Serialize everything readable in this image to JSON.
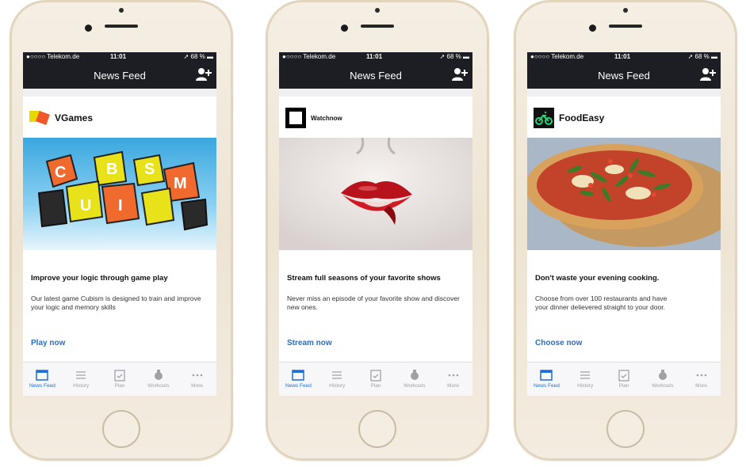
{
  "status": {
    "carrier": "●○○○○ Telekom.de",
    "time": "11:01",
    "battery": "68 %"
  },
  "nav": {
    "title": "News Feed"
  },
  "tabs": [
    {
      "label": "News Feed",
      "icon": "news-feed-icon"
    },
    {
      "label": "History",
      "icon": "history-icon"
    },
    {
      "label": "Plan",
      "icon": "plan-icon"
    },
    {
      "label": "Workouts",
      "icon": "workouts-icon"
    },
    {
      "label": "More",
      "icon": "more-icon"
    }
  ],
  "colors": {
    "accent": "#1f6fd6",
    "bar": "#1c1e23"
  },
  "phones": [
    {
      "brand": "VGames",
      "hero_text": [
        "C",
        "U",
        "B",
        "S",
        "I",
        "M"
      ],
      "headline": "Improve your logic through game play",
      "body": "Our latest game Cubism is designed to train and improve your logic and memory skills",
      "cta": "Play now"
    },
    {
      "brand": "Watchnow",
      "headline": "Stream full seasons of your favorite shows",
      "body": "Never miss an episode of your favorite show and discover new ones.",
      "cta": "Stream now"
    },
    {
      "brand": "FoodEasy",
      "headline": "Don't waste your evening cooking.",
      "body": "Choose from over 100 restaurants and have your dinner delievered straight to your door.",
      "cta": "Choose now"
    }
  ]
}
